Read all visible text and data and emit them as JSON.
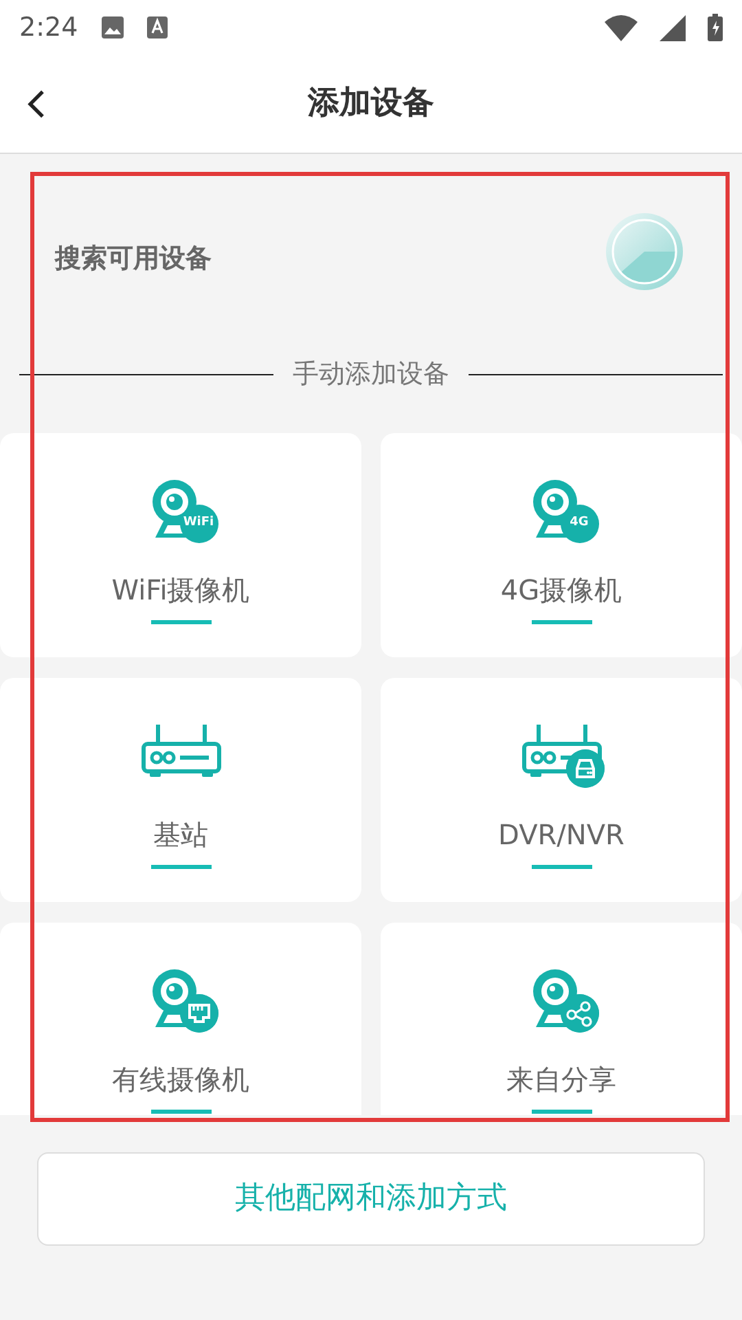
{
  "status_bar": {
    "time": "2:24"
  },
  "header": {
    "title": "添加设备"
  },
  "search": {
    "label": "搜索可用设备"
  },
  "manual_section": {
    "title": "手动添加设备"
  },
  "devices": [
    {
      "kind": "wifi",
      "label": "WiFi摄像机",
      "badge": "WiFi"
    },
    {
      "kind": "cellular",
      "label": "4G摄像机",
      "badge": "4G"
    },
    {
      "kind": "station",
      "label": "基站"
    },
    {
      "kind": "recorder",
      "label": "DVR/NVR"
    },
    {
      "kind": "wired",
      "label": "有线摄像机"
    },
    {
      "kind": "shared",
      "label": "来自分享"
    }
  ],
  "other_button": {
    "label": "其他配网和添加方式"
  }
}
